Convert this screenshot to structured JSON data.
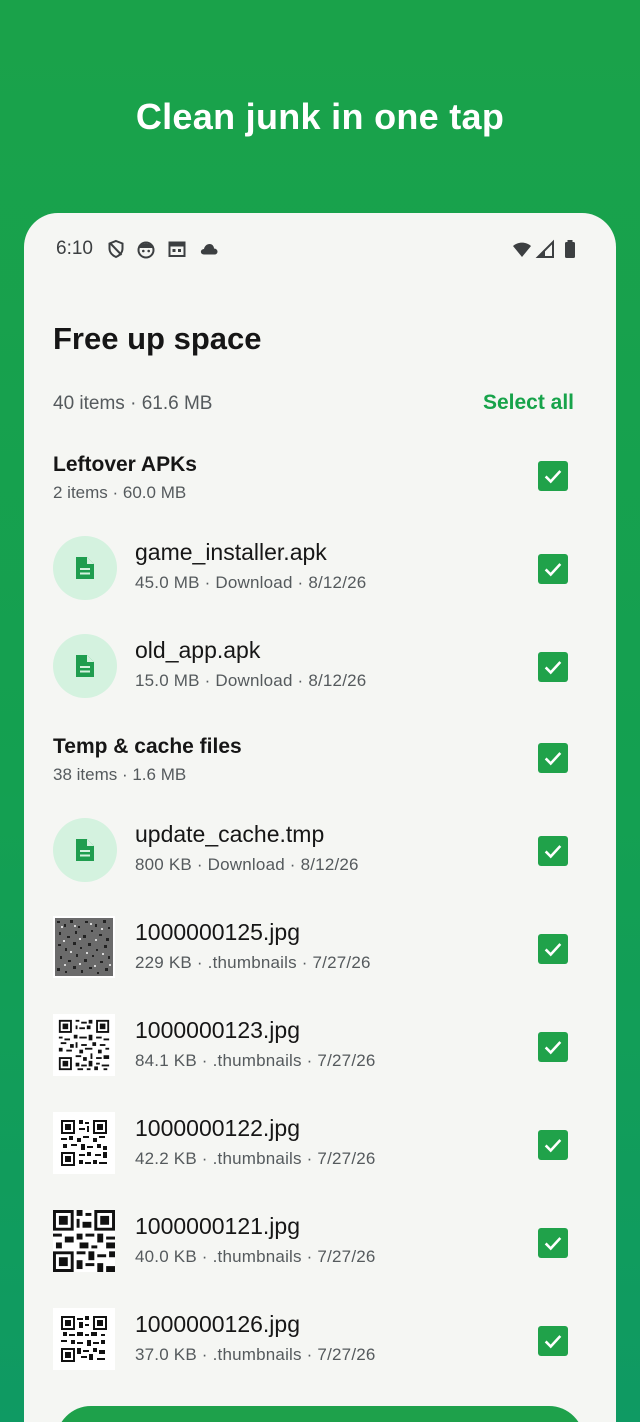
{
  "hero": {
    "headline": "Clean junk in one tap"
  },
  "status_bar": {
    "time": "6:10",
    "left_icons": [
      "shield-icon",
      "face-icon",
      "calendar-icon",
      "cloud-icon"
    ],
    "right_icons": [
      "wifi-icon",
      "signal-icon",
      "battery-icon"
    ]
  },
  "screen": {
    "title": "Free up space",
    "summary": "40 items · 61.6 MB",
    "select_all": "Select all"
  },
  "groups": [
    {
      "title": "Leftover APKs",
      "subtitle": "2 items · 60.0 MB",
      "checked": true,
      "items": [
        {
          "name": "game_installer.apk",
          "meta": "45.0 MB · Download · 8/12/26",
          "icon": "document-icon",
          "checked": true
        },
        {
          "name": "old_app.apk",
          "meta": "15.0 MB · Download · 8/12/26",
          "icon": "document-icon",
          "checked": true
        }
      ]
    },
    {
      "title": "Temp & cache files",
      "subtitle": "38 items · 1.6 MB",
      "checked": true,
      "items": [
        {
          "name": "update_cache.tmp",
          "meta": "800 KB · Download · 8/12/26",
          "icon": "document-icon",
          "checked": true
        },
        {
          "name": "1000000125.jpg",
          "meta": "229 KB · .thumbnails · 7/27/26",
          "icon": "noise-thumbnail",
          "checked": true
        },
        {
          "name": "1000000123.jpg",
          "meta": "84.1 KB · .thumbnails · 7/27/26",
          "icon": "qr-thumbnail",
          "checked": true
        },
        {
          "name": "1000000122.jpg",
          "meta": "42.2 KB · .thumbnails · 7/27/26",
          "icon": "qr-thumbnail",
          "checked": true
        },
        {
          "name": "1000000121.jpg",
          "meta": "40.0 KB · .thumbnails · 7/27/26",
          "icon": "qr-thumbnail",
          "checked": true
        },
        {
          "name": "1000000126.jpg",
          "meta": "37.0 KB · .thumbnails · 7/27/26",
          "icon": "qr-thumbnail",
          "checked": true
        }
      ]
    }
  ],
  "colors": {
    "accent": "#17a34a",
    "checkbox": "#20a24a",
    "icon_circle": "#d4f2df",
    "sheet_bg": "#f5f6f3"
  }
}
